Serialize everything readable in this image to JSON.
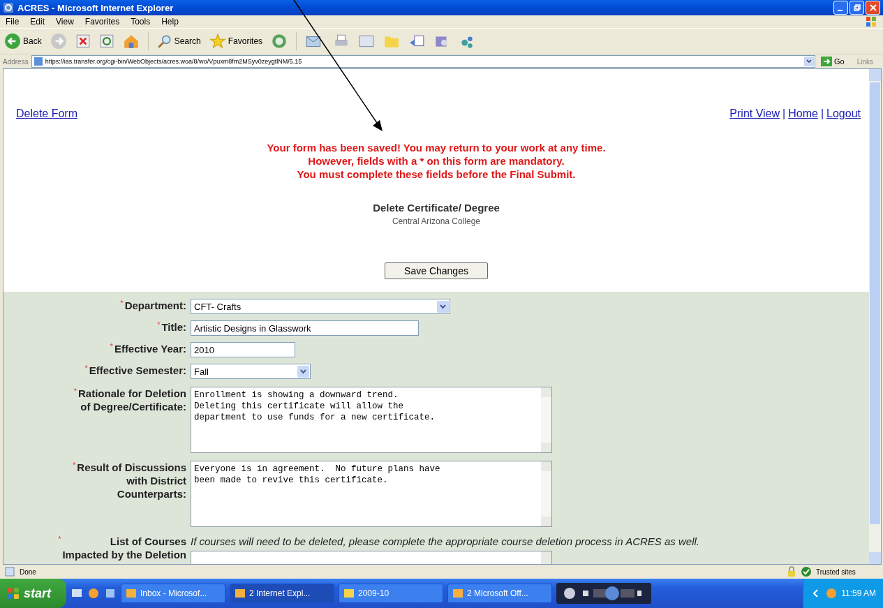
{
  "window": {
    "title": "ACRES - Microsoft Internet Explorer"
  },
  "menu": [
    "File",
    "Edit",
    "View",
    "Favorites",
    "Tools",
    "Help"
  ],
  "toolbar": {
    "back": "Back",
    "search": "Search",
    "favorites": "Favorites"
  },
  "address": {
    "label": "Address",
    "value": "https://ias.transfer.org/cgi-bin/WebObjects/acres.woa/8/wo/Vpuxm8fm2MSyv0zeygtlNM/5.15",
    "go": "Go",
    "links": "Links"
  },
  "page": {
    "left_link": "Delete Form",
    "right_links": [
      "Print View",
      "Home",
      "Logout"
    ],
    "separator": "|",
    "messages": [
      "Your form has been saved! You may return to your work at any time.",
      "However, fields with a * on this form are mandatory.",
      "You must complete these fields before the Final Submit."
    ],
    "heading": "Delete Certificate/ Degree",
    "subheading": "Central Arizona College",
    "save_button": "Save Changes"
  },
  "fields": [
    {
      "kind": "select",
      "asterisk": "*",
      "label": "Department:",
      "value": "CFT- Crafts"
    },
    {
      "kind": "text",
      "asterisk": "*",
      "label": "Title:",
      "value": "Artistic Designs in Glasswork"
    },
    {
      "kind": "text",
      "asterisk": "*",
      "label": "Effective Year:",
      "value": "2010"
    },
    {
      "kind": "select",
      "asterisk": "*",
      "label": "Effective Semester:",
      "value": "Fall"
    },
    {
      "kind": "textarea",
      "asterisk": "*",
      "label": "Rationale for Deletion\nof Degree/Certificate:",
      "value": "Enrollment is showing a downward trend.\nDeleting this certificate will allow the\ndepartment to use funds for a new certificate."
    },
    {
      "kind": "textarea",
      "asterisk": "*",
      "label": "Result of Discussions\nwith District\nCounterparts:",
      "value": "Everyone is in agreement.  No future plans have\nbeen made to revive this certificate."
    },
    {
      "kind": "textarea",
      "asterisk": "*",
      "label": "List of Courses\nImpacted by the Deletion",
      "note": "If courses will need to be deleted, please complete the appropriate course deletion process in ACRES as well."
    }
  ],
  "status_bar": {
    "text": "Done",
    "zone": "Trusted sites"
  },
  "taskbar": {
    "start": "start",
    "items": [
      "Inbox - Microsof...",
      "2 Internet Expl...",
      "2009-10",
      "2 Microsoft Off..."
    ],
    "clock": "11:59 AM"
  }
}
